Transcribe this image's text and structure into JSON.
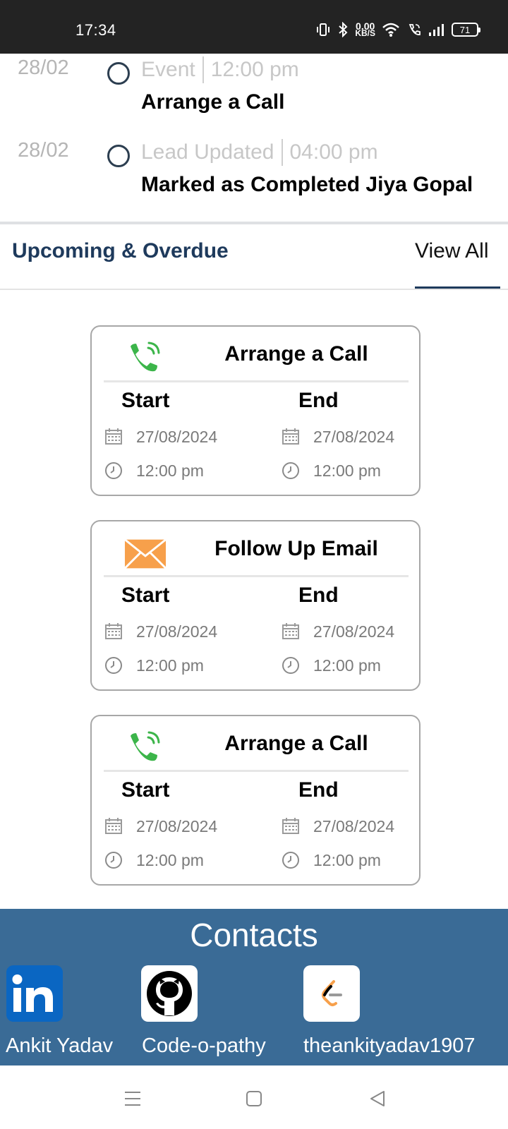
{
  "status_bar": {
    "time": "17:34",
    "net_speed_value": "0.00",
    "net_speed_unit": "KB/S",
    "battery": "71",
    "icons": [
      "vibrate-icon",
      "bluetooth-icon",
      "wifi-icon",
      "volte-icon",
      "signal-icon",
      "battery-icon"
    ]
  },
  "timeline": [
    {
      "date": "28/02",
      "type": "Event",
      "time": "12:00 pm",
      "title": "Arrange a Call"
    },
    {
      "date": "28/02",
      "type": "Lead Updated",
      "time": "04:00 pm",
      "title": "Marked as Completed Jiya Gopal"
    }
  ],
  "section": {
    "title": "Upcoming & Overdue",
    "view_all": "View All"
  },
  "cards": [
    {
      "icon": "phone-icon",
      "title": "Arrange a Call",
      "start_label": "Start",
      "end_label": "End",
      "start_date": "27/08/2024",
      "end_date": "27/08/2024",
      "start_time": "12:00 pm",
      "end_time": "12:00 pm"
    },
    {
      "icon": "email-icon",
      "title": "Follow Up Email",
      "start_label": "Start",
      "end_label": "End",
      "start_date": "27/08/2024",
      "end_date": "27/08/2024",
      "start_time": "12:00 pm",
      "end_time": "12:00 pm"
    },
    {
      "icon": "phone-icon",
      "title": "Arrange a Call",
      "start_label": "Start",
      "end_label": "End",
      "start_date": "27/08/2024",
      "end_date": "27/08/2024",
      "start_time": "12:00 pm",
      "end_time": "12:00 pm"
    }
  ],
  "contacts": {
    "title": "Contacts",
    "items": [
      {
        "icon": "linkedin-icon",
        "label": "Ankit Yadav"
      },
      {
        "icon": "github-icon",
        "label": "Code-o-pathy"
      },
      {
        "icon": "leetcode-icon",
        "label": "theankityadav1907"
      }
    ]
  },
  "colors": {
    "accent": "#1e3a5c",
    "contacts_bg": "#3a6b96",
    "phone_green": "#3cb54a",
    "email_orange": "#f7a04b"
  }
}
